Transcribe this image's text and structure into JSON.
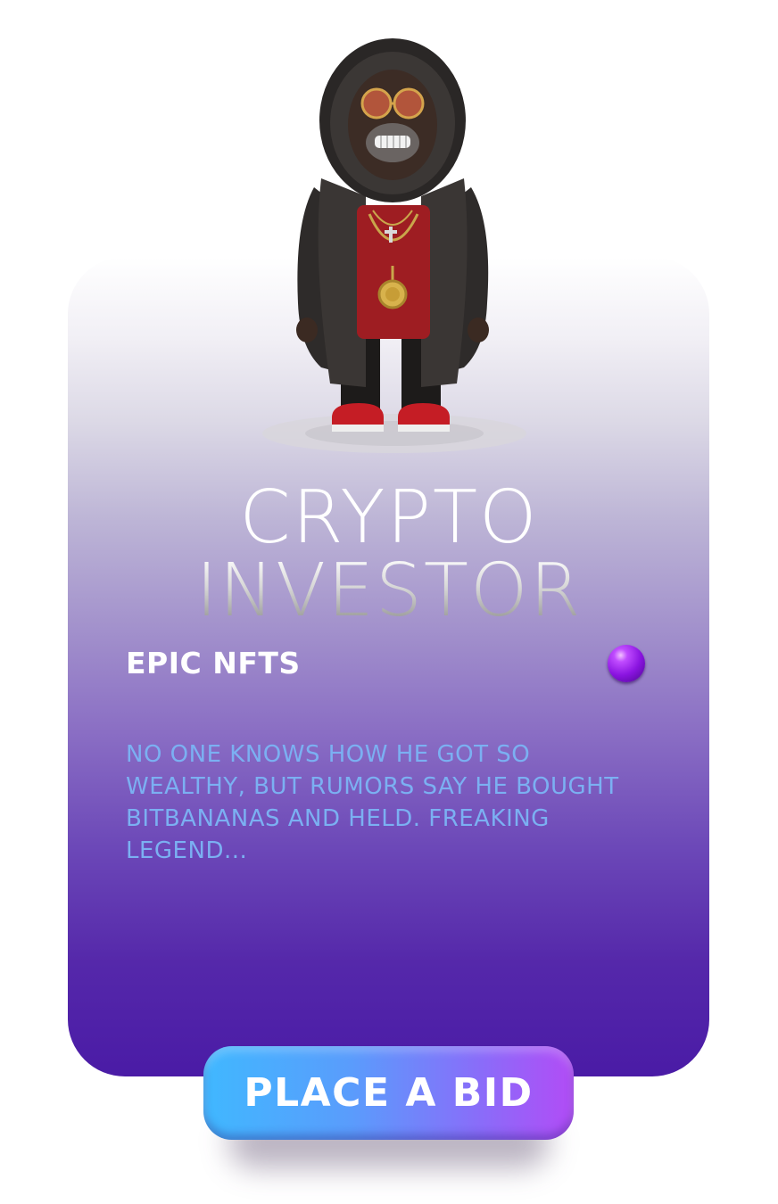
{
  "card": {
    "title_line_1": "CRYPTO",
    "title_line_2": "INVESTOR",
    "collection": "EPIC NFTS",
    "description": "NO ONE KNOWS HOW HE GOT SO WEALTHY, BUT RUMORS SAY HE BOUGHT BITBANANAS AND HELD. FREAKING LEGEND...",
    "character_icon": "monkey-character-fur-coat",
    "orb_icon": "purple-gem-icon"
  },
  "cta": {
    "bid_label": "PLACE A BID"
  },
  "colors": {
    "card_top": "#ffffff",
    "card_bottom": "#4a1ba6",
    "description_text": "#7bb0f2",
    "button_start": "#40b8ff",
    "button_end": "#b24cf6"
  }
}
